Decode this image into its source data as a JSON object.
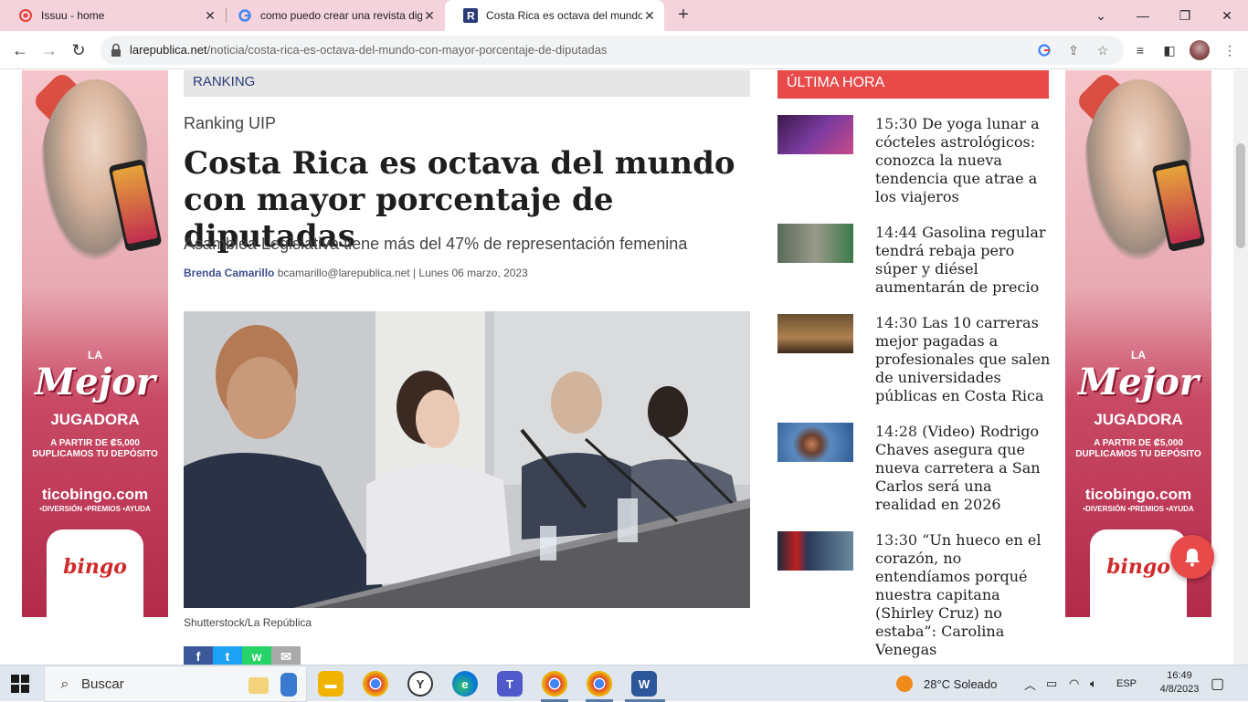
{
  "browser": {
    "tabs": [
      {
        "title": "Issuu - home",
        "icon": "issuu-icon",
        "active": false
      },
      {
        "title": "como puedo crear una revista dig",
        "icon": "google-icon",
        "active": false
      },
      {
        "title": "Costa Rica es octava del mundo c",
        "icon": "larepublica-icon",
        "active": true
      }
    ],
    "new_tab_label": "+",
    "url_domain": "larepublica.net",
    "url_path": "/noticia/costa-rica-es-octava-del-mundo-con-mayor-porcentaje-de-diputadas"
  },
  "ad": {
    "line1": "LA",
    "line2": "Mejor",
    "line3": "JUGADORA",
    "line4": "A PARTIR DE ₡5,000 DUPLICAMOS TU DEPÓSITO",
    "line5": "ticobingo.com",
    "line6": "•DIVERSIÓN •PREMIOS •AYUDA",
    "logo": "bingo"
  },
  "article": {
    "section": "RANKING",
    "kicker": "Ranking UIP",
    "headline": "Costa Rica es octava del mundo con mayor porcentaje de diputadas",
    "subtitle": "Asamblea Legislativa tiene más del 47% de representación femenina",
    "author": "Brenda Camarillo",
    "byline_rest": " bcamarillo@larepublica.net | Lunes 06 marzo, 2023",
    "caption": "Shutterstock/La República",
    "share": [
      "f",
      "t",
      "w",
      "✉"
    ]
  },
  "sidebar": {
    "header": "ÚLTIMA HORA",
    "news": [
      {
        "time": "15:30",
        "title": "De yoga lunar a cócteles astrológicos: conozca la nueva tendencia que atrae a los viajeros"
      },
      {
        "time": "14:44",
        "title": "Gasolina regular tendrá rebaja pero súper y diésel aumentarán de precio"
      },
      {
        "time": "14:30",
        "title": "Las 10 carreras mejor pagadas a profesionales que salen de universidades públicas en Costa Rica"
      },
      {
        "time": "14:28",
        "title": "(Video) Rodrigo Chaves asegura que nueva carretera a San Carlos será una realidad en 2026"
      },
      {
        "time": "13:30",
        "title": "“Un hueco en el corazón, no entendíamos porqué nuestra capitana (Shirley Cruz) no estaba”: Carolina Venegas"
      }
    ]
  },
  "taskbar": {
    "search_placeholder": "Buscar",
    "weather": "28°C  Soleado",
    "lang": "ESP",
    "time": "16:49",
    "date": "4/8/2023"
  },
  "colors": {
    "tab_bg": "#f4d3dc",
    "brand_red": "#e84a4a",
    "author_blue": "#3d4f8f"
  }
}
